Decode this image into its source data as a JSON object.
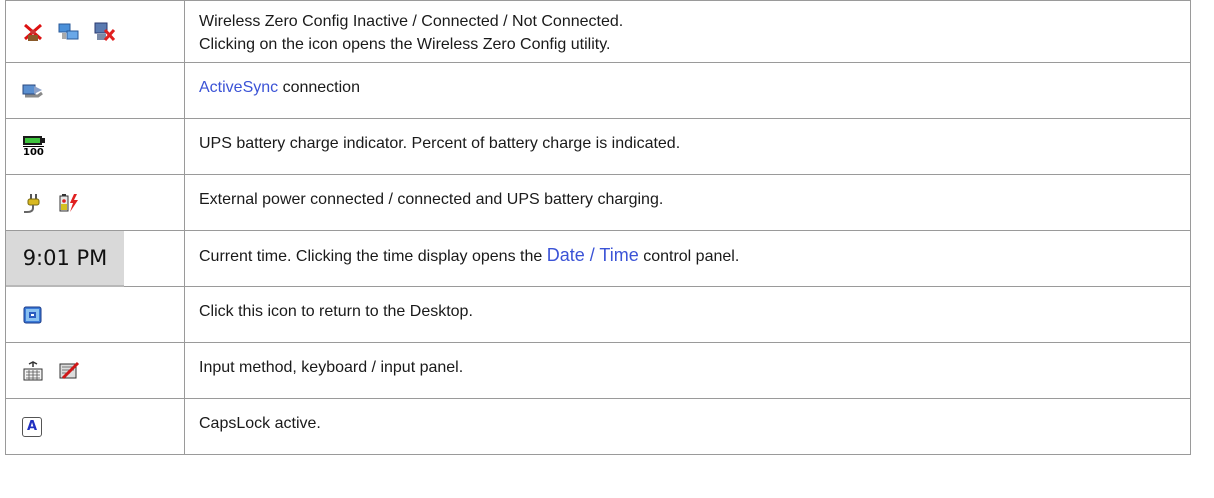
{
  "rows": [
    {
      "icons": [
        "wireless-inactive-icon",
        "wireless-connected-icon",
        "wireless-not-connected-icon"
      ],
      "line1": "Wireless Zero Config Inactive / Connected / Not Connected.",
      "line2": "Clicking on the icon opens the Wireless Zero Config utility."
    },
    {
      "icons": [
        "activesync-icon"
      ],
      "link": "ActiveSync",
      "text": " connection"
    },
    {
      "icons": [
        "battery-charge-icon"
      ],
      "battery_label": "100",
      "text": "UPS battery charge indicator. Percent of battery charge is indicated."
    },
    {
      "icons": [
        "external-power-icon",
        "battery-charging-icon"
      ],
      "text": "External power connected / connected and UPS battery charging."
    },
    {
      "clock": "9:01 PM",
      "text_before": "Current time. Clicking the time display opens the ",
      "link": "Date / Time",
      "text_after": " control panel."
    },
    {
      "icons": [
        "desktop-icon"
      ],
      "text": "Click this icon to return to the Desktop."
    },
    {
      "icons": [
        "keyboard-icon",
        "input-panel-icon"
      ],
      "text": "Input method, keyboard / input panel."
    },
    {
      "icons": [
        "capslock-icon"
      ],
      "capslock_letter": "A",
      "text": "CapsLock active."
    }
  ],
  "colors": {
    "link": "#3b53d6",
    "border": "#9a9a9a",
    "text": "#1a1a1a"
  }
}
